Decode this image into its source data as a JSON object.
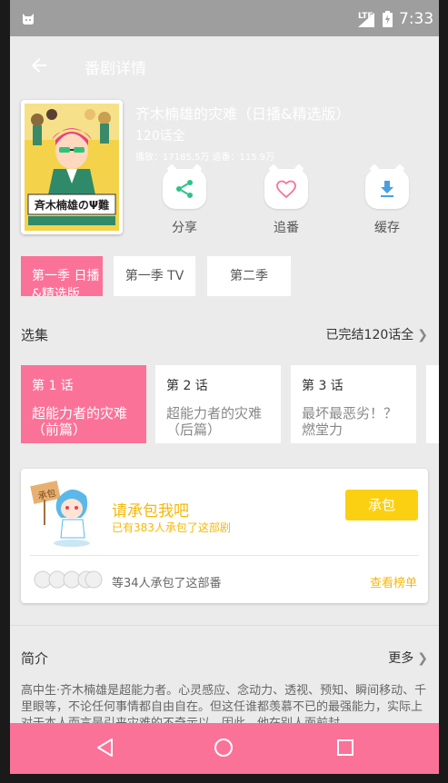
{
  "status_bar": {
    "network": "LTE",
    "time": "7:33"
  },
  "app_bar": {
    "title": "番剧详情",
    "back_icon": "arrow-back-icon"
  },
  "anime": {
    "title": "齐木楠雄的灾难（日播&精选版）",
    "episodes_total": "120话全",
    "stats": "播放：17185.5万 追番：115.9万",
    "cover_text": "斉木楠雄のΨ難"
  },
  "actions": [
    {
      "label": "分享",
      "icon": "share-icon"
    },
    {
      "label": "追番",
      "icon": "heart-icon"
    },
    {
      "label": "缓存",
      "icon": "download-icon"
    }
  ],
  "seasons": [
    {
      "label": "第一季 日播&精选版",
      "active": true
    },
    {
      "label": "第一季 TV",
      "active": false
    },
    {
      "label": "第二季",
      "active": false
    }
  ],
  "episode_section": {
    "title": "选集",
    "right_label": "已完结120话全"
  },
  "episodes": [
    {
      "num": "第 1 话",
      "name": "超能力者的灾难（前篇）",
      "active": true
    },
    {
      "num": "第 2 话",
      "name": "超能力者的灾难（后篇）",
      "active": false
    },
    {
      "num": "第 3 话",
      "name": "最坏最恶劣！？燃堂力",
      "active": false
    }
  ],
  "sponsor": {
    "sign_text": "承包",
    "headline": "请承包我吧",
    "subtitle": "已有383人承包了这部剧",
    "button": "承包",
    "count_text": "等34人承包了这部番",
    "rank_link": "查看榜单"
  },
  "intro_section": {
    "title": "简介",
    "more": "更多"
  },
  "description": "高中生·齐木楠雄是超能力者。心灵感应、念动力、透视、预知、瞬间移动、千里眼等，不论任何事情都自由自在。但这任谁都羡慕不已的最强能力，实际上对于本人而言是引来灾难的不奇示以。因此，他在别人面前封",
  "colors": {
    "accent": "#fb7299",
    "sponsor": "#fcd012",
    "background": "#ebebeb"
  }
}
